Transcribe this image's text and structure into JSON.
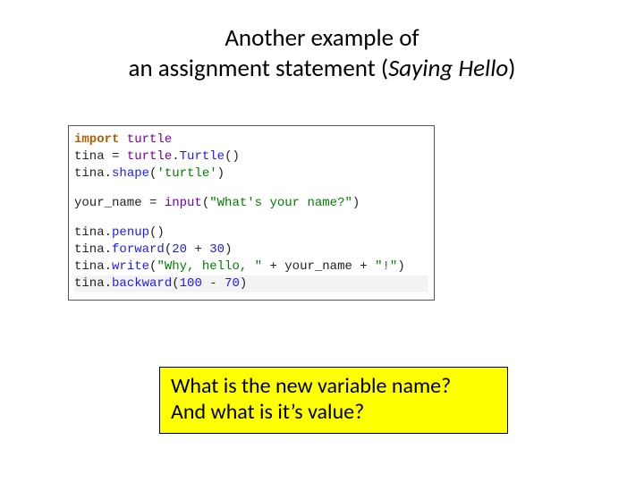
{
  "title": {
    "line1": "Another example of",
    "line2_plain": "an assignment statement (",
    "line2_italic": "Saying Hello",
    "line2_close": ")"
  },
  "code": {
    "l1": {
      "kw": "import",
      "mod": "turtle"
    },
    "l2": {
      "lhs": "tina = ",
      "obj": "turtle",
      "dot": ".",
      "call": "Turtle",
      "rest": "()"
    },
    "l3": {
      "obj": "tina",
      "dot": ".",
      "call": "shape",
      "paren_o": "(",
      "str": "'turtle'",
      "paren_c": ")"
    },
    "l4": {
      "lhs": "your_name = ",
      "builtin": "input",
      "paren_o": "(",
      "str": "\"What's your name?\"",
      "paren_c": ")"
    },
    "l5": {
      "obj": "tina",
      "dot": ".",
      "call": "penup",
      "rest": "()"
    },
    "l6": {
      "obj": "tina",
      "dot": ".",
      "call": "forward",
      "paren_o": "(",
      "n1": "20",
      "plus": " + ",
      "n2": "30",
      "paren_c": ")"
    },
    "l7": {
      "obj": "tina",
      "dot": ".",
      "call": "write",
      "paren_o": "(",
      "s1": "\"Why, hello, \"",
      "plus1": " + your_name + ",
      "s2": "\"!\"",
      "paren_c": ")"
    },
    "l8": {
      "obj": "tina",
      "dot": ".",
      "call": "backward",
      "paren_o": "(",
      "n1": "100",
      "minus": " - ",
      "n2": "70",
      "paren_c": ")"
    }
  },
  "callout": {
    "line1": "What is the new variable name?",
    "line2": "And what is it’s value?"
  }
}
